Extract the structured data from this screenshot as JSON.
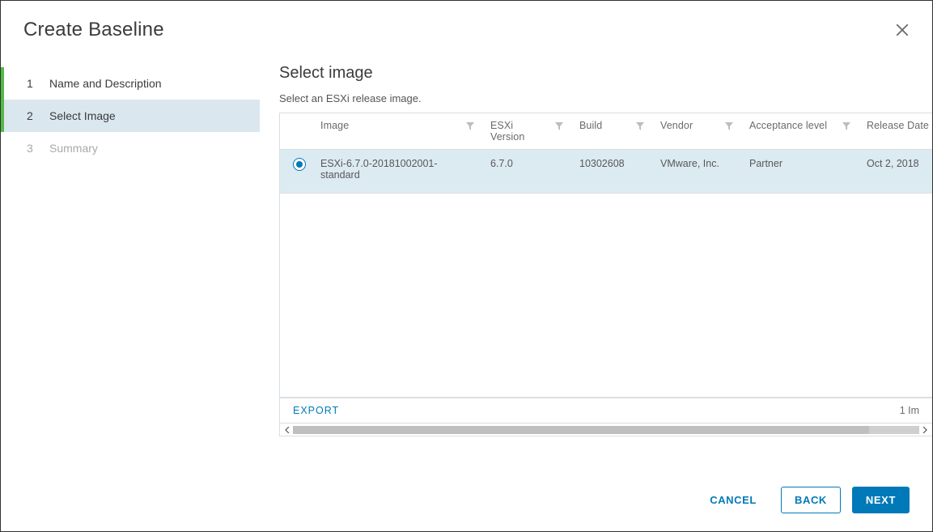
{
  "dialog": {
    "title": "Create Baseline"
  },
  "steps": [
    {
      "num": "1",
      "label": "Name and Description",
      "state": "done"
    },
    {
      "num": "2",
      "label": "Select Image",
      "state": "active"
    },
    {
      "num": "3",
      "label": "Summary",
      "state": "future"
    }
  ],
  "page": {
    "title": "Select image",
    "subtitle": "Select an ESXi release image."
  },
  "table": {
    "columns": {
      "image": "Image",
      "esxi_version": "ESXi Version",
      "build": "Build",
      "vendor": "Vendor",
      "acceptance": "Acceptance level",
      "release_date": "Release Date"
    },
    "rows": [
      {
        "selected": true,
        "image": "ESXi-6.7.0-20181002001-standard",
        "esxi_version": "6.7.0",
        "build": "10302608",
        "vendor": "VMware, Inc.",
        "acceptance": "Partner",
        "release_date": "Oct 2, 2018"
      }
    ],
    "export_label": "EXPORT",
    "count_label": "1 Im"
  },
  "footer": {
    "cancel": "CANCEL",
    "back": "BACK",
    "next": "NEXT"
  }
}
